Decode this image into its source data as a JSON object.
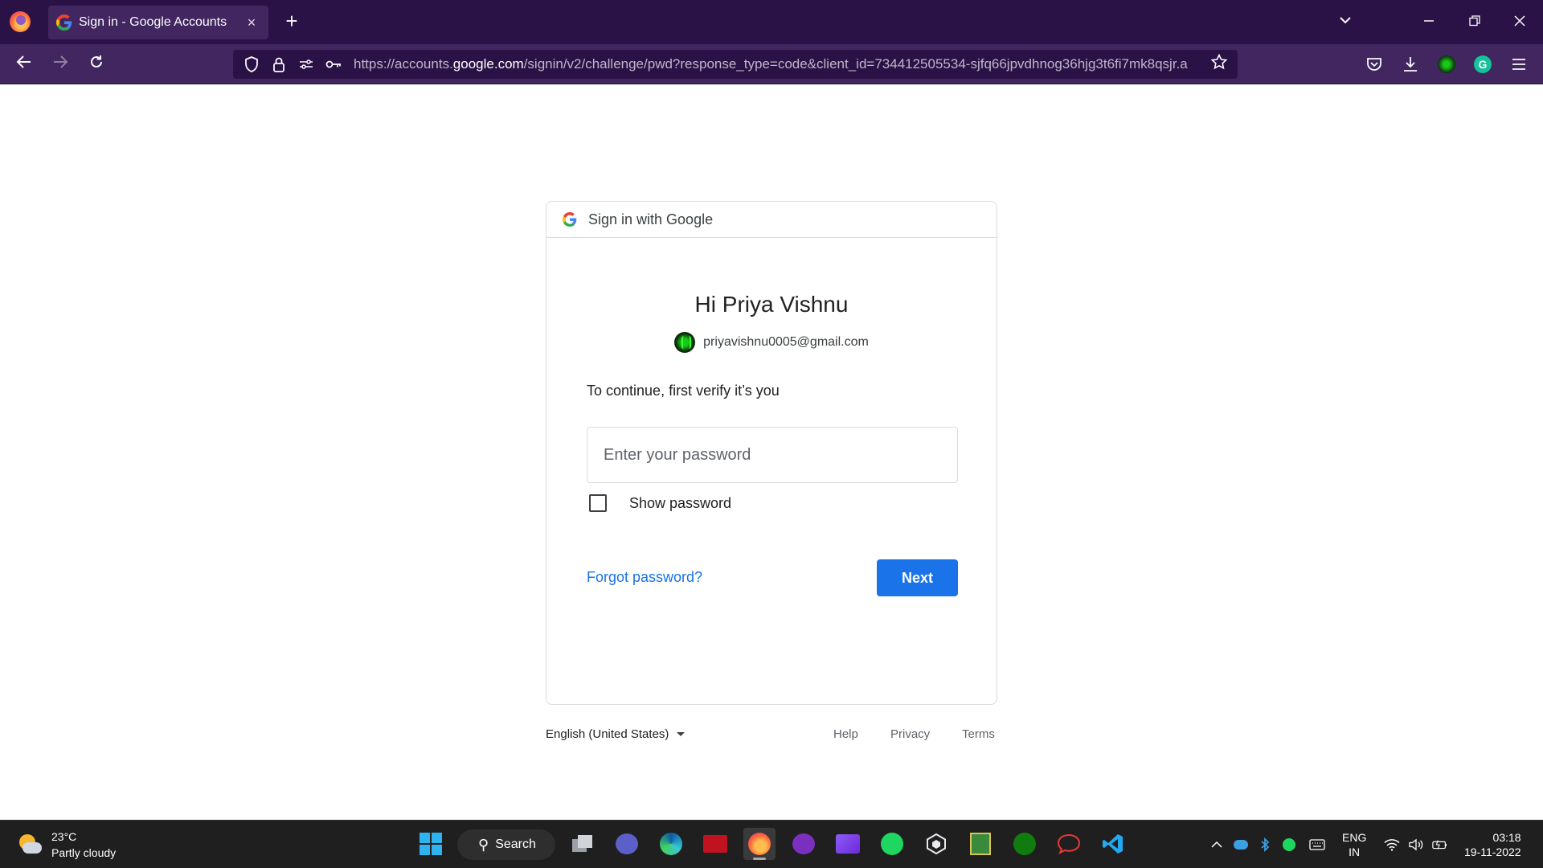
{
  "browser": {
    "tab_title": "Sign in - Google Accounts",
    "tab_close": "×",
    "new_tab": "+",
    "url_prefix": "https://accounts.",
    "url_domain": "google.com",
    "url_path": "/signin/v2/challenge/pwd?response_type=code&client_id=734412505534-sjfq66jpvdhnog36hjg3t6fi7mk8qsjr.a",
    "colors": {
      "tabbar": "#2b1246",
      "navbar": "#42265f"
    }
  },
  "card": {
    "header": "Sign in with Google",
    "greeting": "Hi Priya Vishnu",
    "email": "priyavishnu0005@gmail.com",
    "verify_text": "To continue, first verify it’s you",
    "password_placeholder": "Enter your password",
    "show_password_label": "Show password",
    "forgot_link": "Forgot password?",
    "next_button": "Next",
    "accent_color": "#1a73e8"
  },
  "footer": {
    "language": "English (United States)",
    "links": {
      "help": "Help",
      "privacy": "Privacy",
      "terms": "Terms"
    }
  },
  "taskbar": {
    "weather_temp": "23°C",
    "weather_desc": "Partly cloudy",
    "search_label": "Search",
    "lang_line1": "ENG",
    "lang_line2": "IN",
    "time": "03:18",
    "date": "19-11-2022"
  }
}
